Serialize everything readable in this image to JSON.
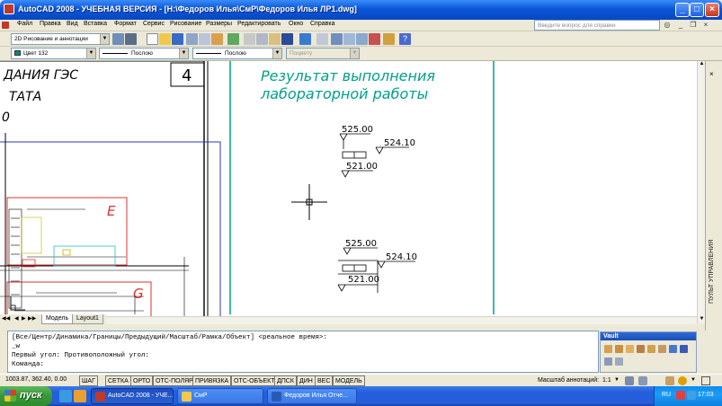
{
  "window": {
    "title": "AutoCAD 2008 - УЧЕБНАЯ ВЕРСИЯ - [H:\\Федоров Илья\\СмР\\Федоров Илья ЛР1.dwg]",
    "min": "_",
    "max": "□",
    "close": "×"
  },
  "menubar": {
    "items": [
      "Файл",
      "Правка",
      "Вид",
      "Вставка",
      "Формат",
      "Сервис",
      "Рисование",
      "Размеры",
      "Редактировать",
      "Окно",
      "Справка"
    ],
    "help_placeholder": "Введите вопрос для справки"
  },
  "toolbar": {
    "workspace": "2D Рисование и аннотации",
    "color": "Цвет 132",
    "linetype": "Послою",
    "lineweight": "Послою",
    "plotstyle": "Поцвету"
  },
  "drawing": {
    "frame_num": "4",
    "title_lines": [
      "Результат выполнения",
      "лабораторной работы"
    ],
    "left_text": [
      "ДАНИЯ ГЭС",
      "ТАТА",
      "0"
    ],
    "letter_e": "E",
    "letter_g": "G",
    "dim1": {
      "top": "525.00",
      "right": "524.10",
      "bottom": "521.00"
    },
    "dim2": {
      "top": "525.00",
      "right": "524.10",
      "bottom": "521.00"
    },
    "accent_color": "#00a08a",
    "red_color": "#e03030",
    "blue_color": "#3030c0"
  },
  "layout_tabs": [
    "Модель",
    "Layout1"
  ],
  "right_panel_label": "ПУЛЬТ УПРАВЛЕНИЯ",
  "command": {
    "lines": [
      "[Все/Центр/Динамика/Границы/Предыдущий/Масштаб/Рамка/Объект] <реальное время>:",
      "_w",
      "Первый угол: Противоположный угол:",
      "Команда:"
    ]
  },
  "vault": {
    "title": "Vault"
  },
  "status": {
    "coords": "1003.87, 362.40, 0.00",
    "buttons": [
      "ШАГ",
      "СЕТКА",
      "ОРТО",
      "ОТС-ПОЛЯР",
      "ПРИВЯЗКА",
      "ОТС-ОБЪЕКТ",
      "ДПСК",
      "ДИН",
      "ВЕС",
      "МОДЕЛЬ"
    ],
    "annotation_label": "Масштаб аннотаций:",
    "annotation_value": "1:1"
  },
  "taskbar": {
    "start": "пуск",
    "tasks": [
      "AutoCAD 2008 - УЧЕ...",
      "СмР",
      "Федоров Илья Отче..."
    ],
    "lang": "RU",
    "time": "17:03"
  }
}
